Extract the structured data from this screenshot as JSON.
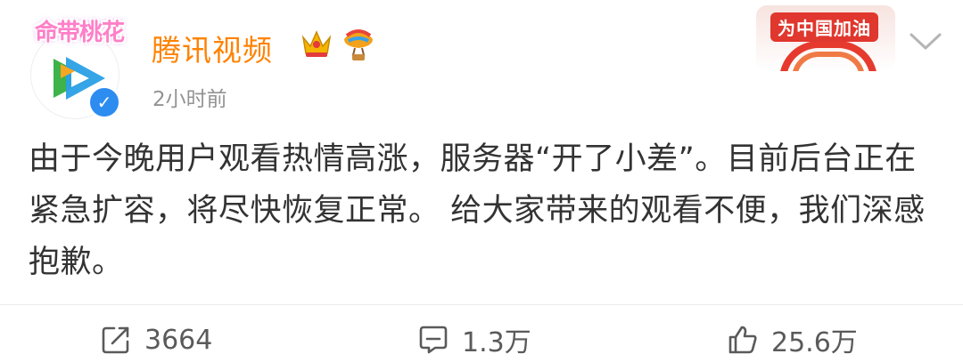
{
  "post": {
    "avatar_frame_text": "命带桃花",
    "username": "腾讯视频",
    "timestamp": "2小时前",
    "campaign_badge": "为中国加油",
    "body": "由于今晚用户观看热情高涨，服务器“开了小差”。目前后台正在紧急扩容，将尽快恢复正常。 给大家带来的观看不便，我们深感抱歉。"
  },
  "actions": {
    "repost_count": "3664",
    "comment_count": "1.3万",
    "like_count": "25.6万"
  },
  "colors": {
    "username": "#ff8200",
    "body_text": "#333333",
    "meta": "#939393",
    "verified": "#2d8cf0"
  },
  "icons": {
    "repost": "repost-icon",
    "comment": "comment-icon",
    "like": "like-icon",
    "more": "chevron-down-icon"
  }
}
